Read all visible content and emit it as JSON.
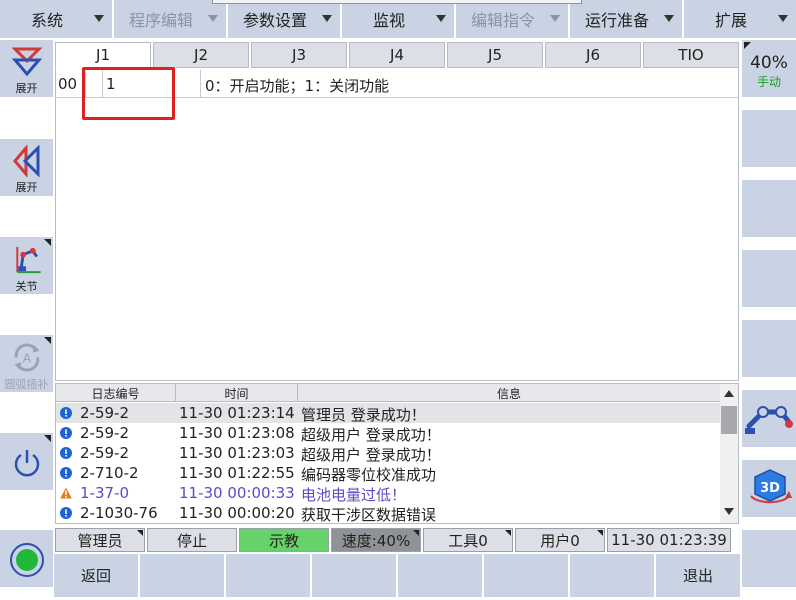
{
  "menu": [
    {
      "label": "系统",
      "disabled": false
    },
    {
      "label": "程序编辑",
      "disabled": true
    },
    {
      "label": "参数设置",
      "disabled": false
    },
    {
      "label": "监视",
      "disabled": false
    },
    {
      "label": "编辑指令",
      "disabled": true
    },
    {
      "label": "运行准备",
      "disabled": false
    },
    {
      "label": "扩展",
      "disabled": false
    }
  ],
  "left": {
    "expand1": "展开",
    "expand2": "展开",
    "joint": "关节",
    "coord": "圆弧插补"
  },
  "tabs": [
    "J1",
    "J2",
    "J3",
    "J4",
    "J5",
    "J6",
    "TIO"
  ],
  "param_row": {
    "id": "00",
    "value": "1",
    "description": "0：开启功能；1：关闭功能"
  },
  "log": {
    "headers": [
      "日志编号",
      "时间",
      "信息"
    ],
    "rows": [
      {
        "code": "2-59-2",
        "time": "11-30 01:23:14",
        "msg": "管理员 登录成功！",
        "level": "info"
      },
      {
        "code": "2-59-2",
        "time": "11-30 01:23:08",
        "msg": "超级用户 登录成功！",
        "level": "info"
      },
      {
        "code": "2-59-2",
        "time": "11-30 01:23:03",
        "msg": "超级用户 登录成功！",
        "level": "info"
      },
      {
        "code": "2-710-2",
        "time": "11-30 01:22:55",
        "msg": "编码器零位校准成功",
        "level": "info"
      },
      {
        "code": "1-37-0",
        "time": "11-30 00:00:33",
        "msg": "电池电量过低！",
        "level": "warning"
      },
      {
        "code": "2-1030-76",
        "time": "11-30 00:00:20",
        "msg": "获取干涉区数据错误",
        "level": "info"
      }
    ]
  },
  "status": {
    "user": "管理员",
    "state": "停止",
    "mode": "示教",
    "speed": "速度:40%",
    "tool": "工具0",
    "usercoord": "用户0",
    "datetime": "11-30 01:23:39"
  },
  "bottom": {
    "back": "返回",
    "exit": "退出"
  },
  "right": {
    "speed_pct": "40%",
    "speed_mode": "手动"
  },
  "colors": {
    "panel": "#c9d3e3",
    "teach_green": "#66d36a",
    "highlight_red": "#e02020",
    "info_blue": "#1e63d6",
    "warn_orange": "#e8791a"
  }
}
